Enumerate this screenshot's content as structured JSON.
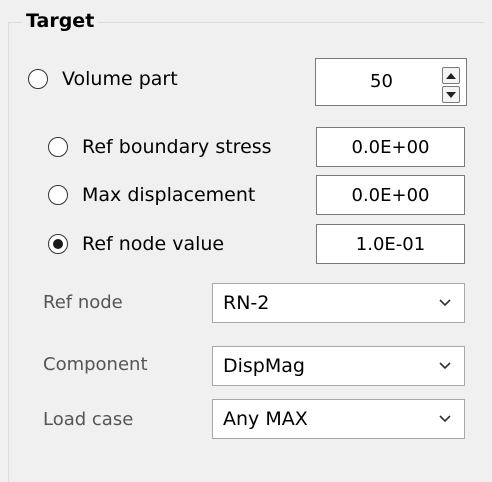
{
  "group": {
    "title": "Target"
  },
  "options": {
    "volume_part": {
      "label": "Volume part",
      "value": "50",
      "selected": false
    },
    "ref_boundary_stress": {
      "label": "Ref boundary stress",
      "value": "0.0E+00",
      "selected": false
    },
    "max_displacement": {
      "label": "Max displacement",
      "value": "0.0E+00",
      "selected": false
    },
    "ref_node_value": {
      "label": "Ref node value",
      "value": "1.0E-01",
      "selected": true
    }
  },
  "ref_node": {
    "label": "Ref node",
    "value": "RN-2"
  },
  "component": {
    "label": "Component",
    "value": "DispMag"
  },
  "load_case": {
    "label": "Load case",
    "value": "Any MAX"
  },
  "icons": {
    "spin_up": "spin-up-icon",
    "spin_down": "spin-down-icon",
    "dropdown": "chevron-down-icon"
  },
  "colors": {
    "background": "#f0f0f0",
    "field_border": "#7a7a7a",
    "combo_border": "#a8a8a8",
    "label_gray": "#555555"
  }
}
